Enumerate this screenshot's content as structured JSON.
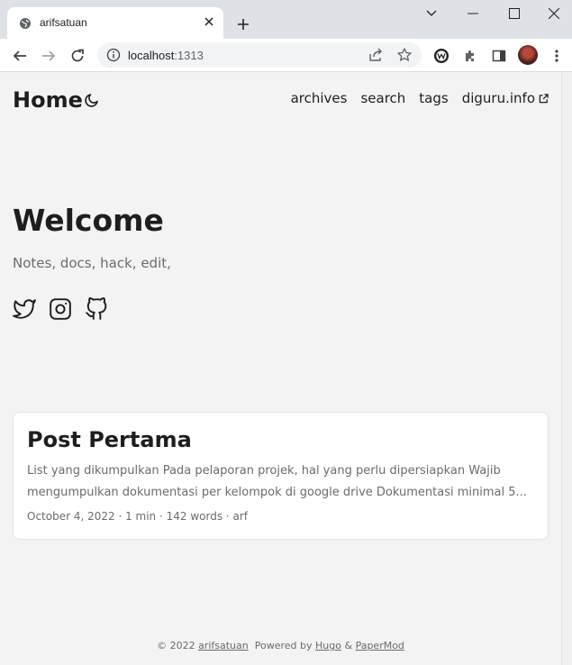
{
  "browser": {
    "tab_title": "arifsatuan",
    "url_host": "localhost",
    "url_port": ":1313"
  },
  "site": {
    "logo": "Home",
    "nav": [
      {
        "label": "archives"
      },
      {
        "label": "search"
      },
      {
        "label": "tags"
      },
      {
        "label": "diguru.info"
      }
    ]
  },
  "hero": {
    "title": "Welcome",
    "subtitle": "Notes, docs, hack, edit,",
    "social_icons": [
      "twitter-icon",
      "instagram-icon",
      "github-icon"
    ]
  },
  "posts": [
    {
      "title": "Post Pertama",
      "summary": "List yang dikumpulkan Pada pelaporan projek, hal yang perlu dipersiapkan Wajib mengumpulkan dokumentasi per kelompok di google drive Dokumentasi minimal 5...",
      "meta": "October 4, 2022 · 1 min · 142 words · arf"
    }
  ],
  "footer": {
    "copyright": "© 2022",
    "site_link": "arifsatuan",
    "powered_by": "Powered by",
    "hugo": "Hugo",
    "amp": "&",
    "theme": "PaperMod"
  }
}
